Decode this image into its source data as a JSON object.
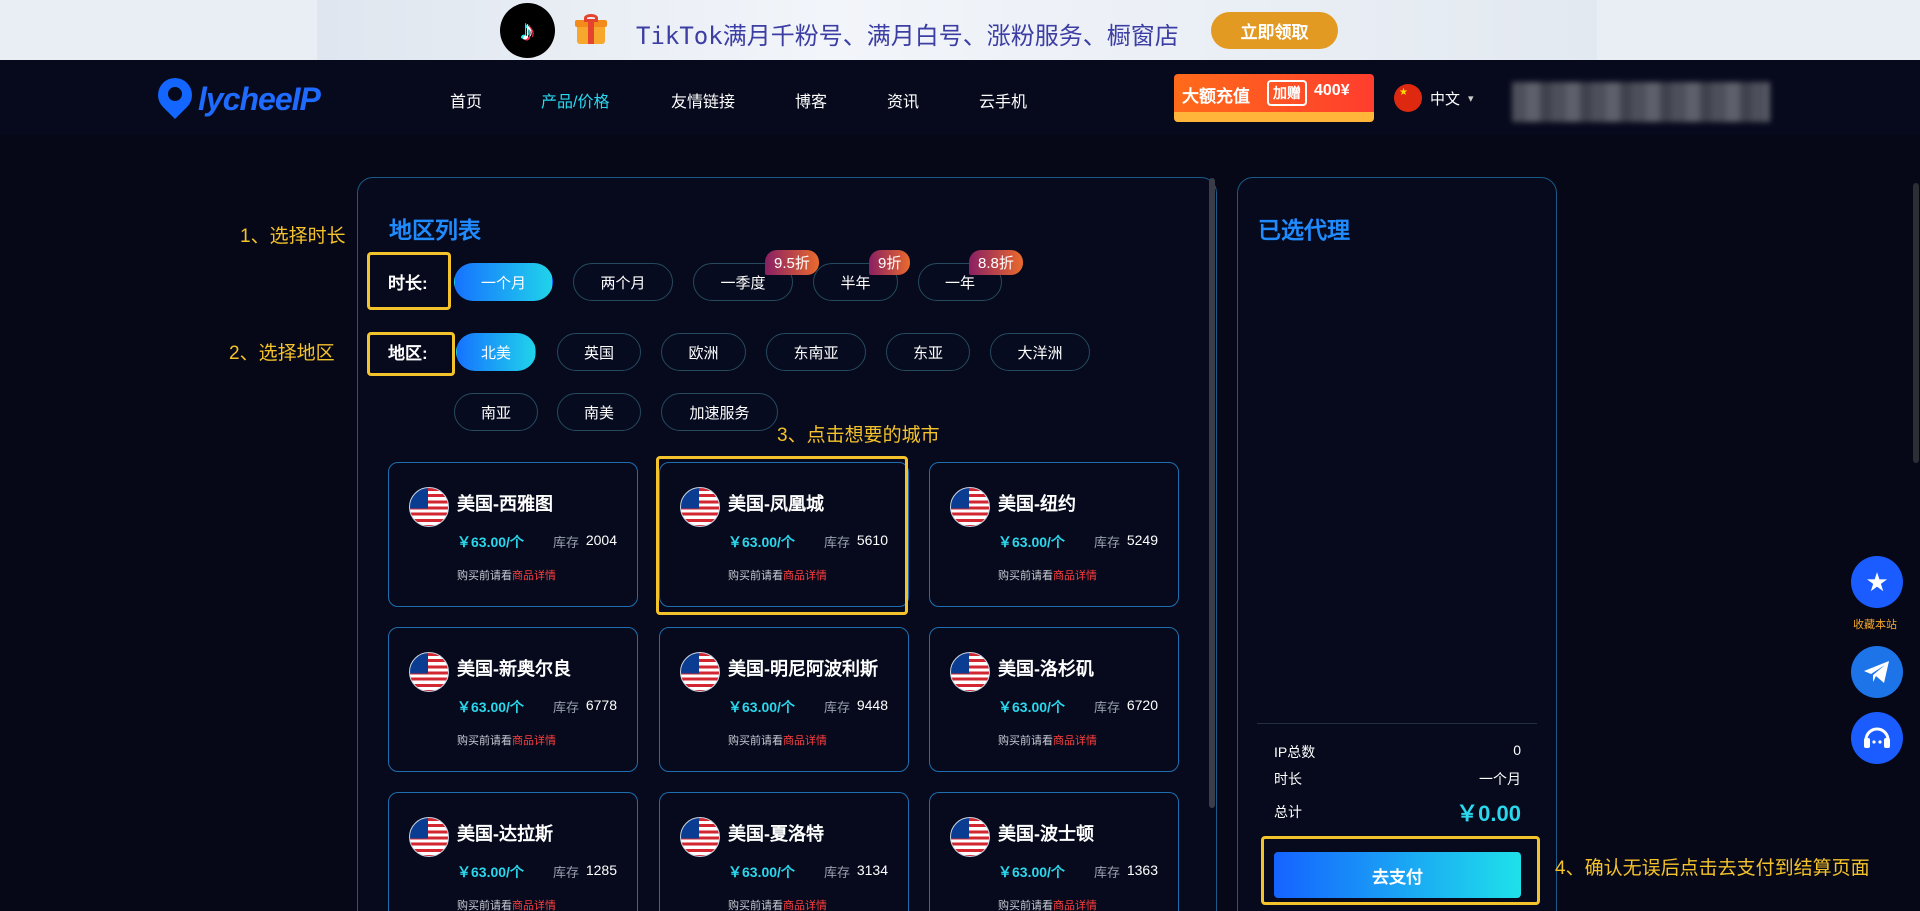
{
  "promo": {
    "text": "TikTok满月千粉号、满月白号、涨粉服务、橱窗店",
    "button": "立即领取",
    "tiktok_icon": "tiktok-icon",
    "gift_icon": "gift-icon"
  },
  "nav": {
    "logo": "lycheeIP",
    "items": [
      "首页",
      "产品/价格",
      "友情链接",
      "博客",
      "资讯",
      "云手机"
    ],
    "active_index": 1,
    "recharge": {
      "text": "大额充值",
      "badge": "加赠",
      "amount": "400¥"
    },
    "language": "中文"
  },
  "region_panel": {
    "title": "地区列表",
    "duration_label": "时长:",
    "durations": [
      {
        "label": "一个月",
        "active": true,
        "discount": ""
      },
      {
        "label": "两个月",
        "active": false,
        "discount": ""
      },
      {
        "label": "一季度",
        "active": false,
        "discount": "9.5折"
      },
      {
        "label": "半年",
        "active": false,
        "discount": "9折"
      },
      {
        "label": "一年",
        "active": false,
        "discount": "8.8折"
      }
    ],
    "region_label": "地区:",
    "regions": [
      "北美",
      "英国",
      "欧洲",
      "东南亚",
      "东亚",
      "大洋洲",
      "南亚",
      "南美",
      "加速服务"
    ],
    "active_region": 0
  },
  "cards": [
    {
      "city": "美国-西雅图",
      "price": "￥63.00/个",
      "stock_label": "库存",
      "stock": "2004",
      "tip": "购买前请看",
      "tip_link": "商品详情"
    },
    {
      "city": "美国-凤凰城",
      "price": "￥63.00/个",
      "stock_label": "库存",
      "stock": "5610",
      "tip": "购买前请看",
      "tip_link": "商品详情"
    },
    {
      "city": "美国-纽约",
      "price": "￥63.00/个",
      "stock_label": "库存",
      "stock": "5249",
      "tip": "购买前请看",
      "tip_link": "商品详情"
    },
    {
      "city": "美国-新奥尔良",
      "price": "￥63.00/个",
      "stock_label": "库存",
      "stock": "6778",
      "tip": "购买前请看",
      "tip_link": "商品详情"
    },
    {
      "city": "美国-明尼阿波利斯",
      "price": "￥63.00/个",
      "stock_label": "库存",
      "stock": "9448",
      "tip": "购买前请看",
      "tip_link": "商品详情"
    },
    {
      "city": "美国-洛杉矶",
      "price": "￥63.00/个",
      "stock_label": "库存",
      "stock": "6720",
      "tip": "购买前请看",
      "tip_link": "商品详情"
    },
    {
      "city": "美国-达拉斯",
      "price": "￥63.00/个",
      "stock_label": "库存",
      "stock": "1285",
      "tip": "购买前请看",
      "tip_link": "商品详情"
    },
    {
      "city": "美国-夏洛特",
      "price": "￥63.00/个",
      "stock_label": "库存",
      "stock": "3134",
      "tip": "购买前请看",
      "tip_link": "商品详情"
    },
    {
      "city": "美国-波士顿",
      "price": "￥63.00/个",
      "stock_label": "库存",
      "stock": "1363",
      "tip": "购买前请看",
      "tip_link": "商品详情"
    }
  ],
  "selected_panel": {
    "title": "已选代理",
    "ip_total_label": "IP总数",
    "ip_total": "0",
    "duration_label": "时长",
    "duration": "一个月",
    "total_label": "总计",
    "total": "￥0.00",
    "pay_button": "去支付"
  },
  "annotations": {
    "step1": "1、选择时长",
    "step2": "2、选择地区",
    "step3": "3、点击想要的城市",
    "step4": "4、确认无误后点击去支付到结算页面"
  },
  "floating": {
    "favorite_label": "收藏本站"
  },
  "colors": {
    "accent": "#1f8bff",
    "cyan": "#2ad7ec",
    "highlight": "#f4c22a",
    "background": "#060818"
  }
}
